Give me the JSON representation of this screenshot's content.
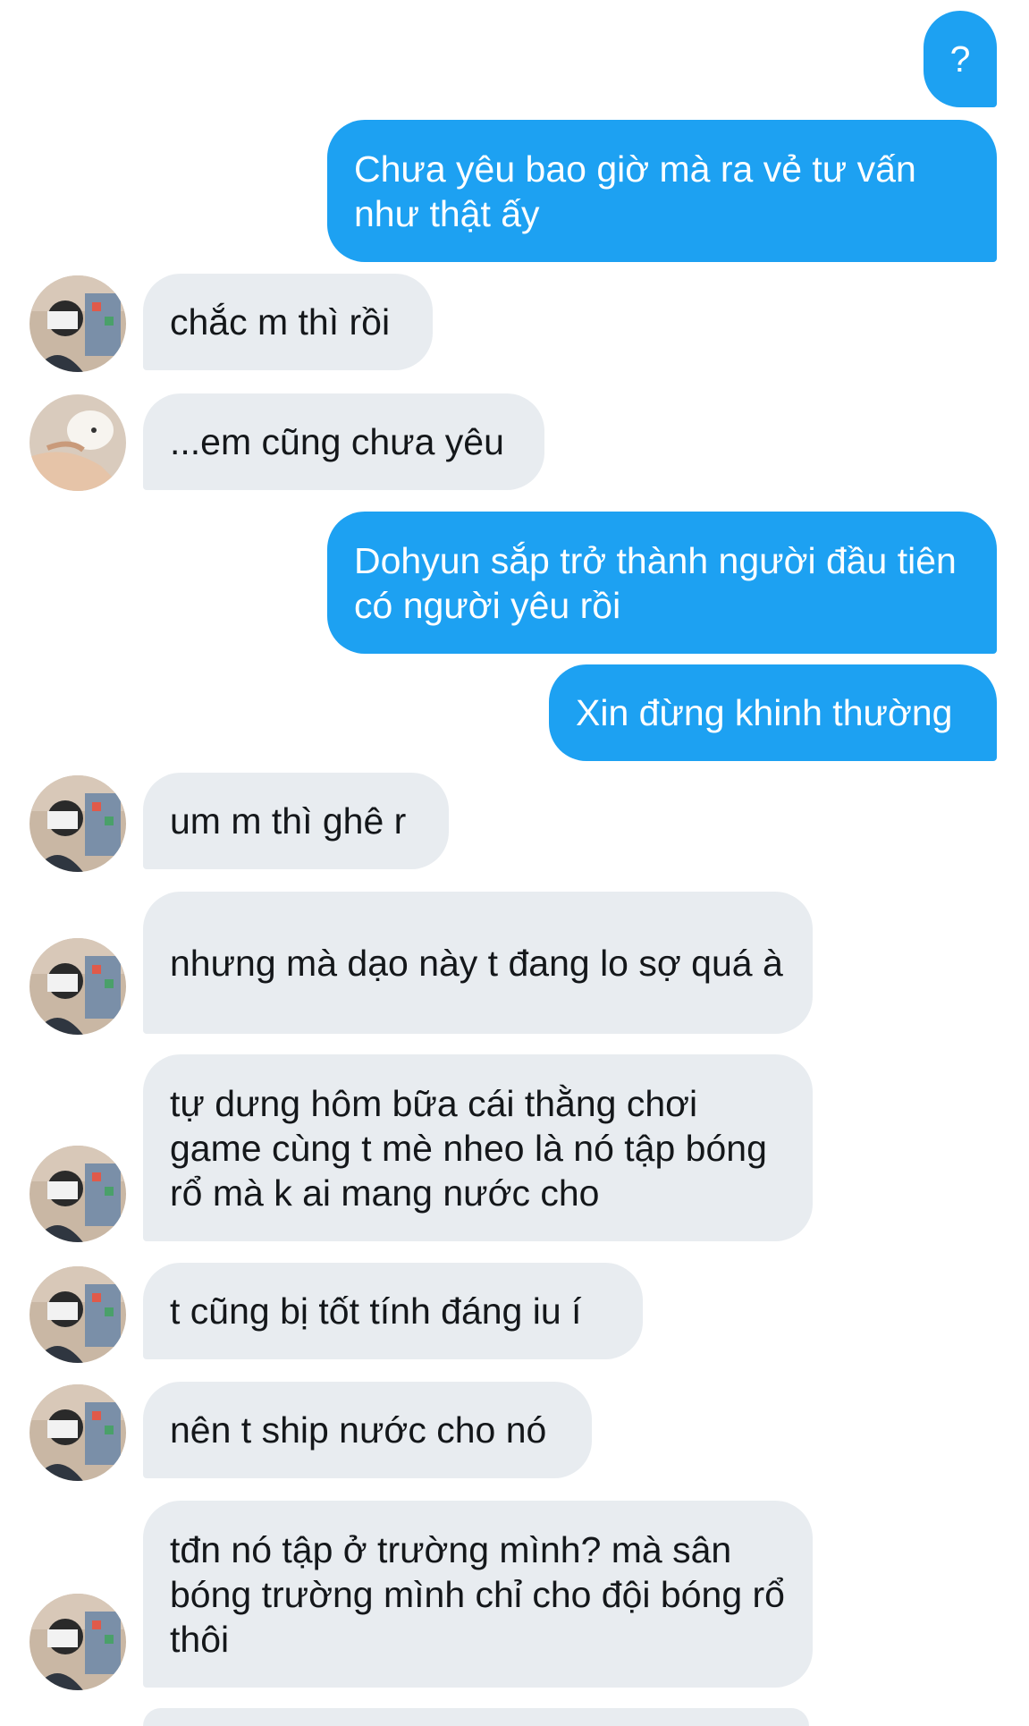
{
  "messages": [
    {
      "side": "sent",
      "text": "?"
    },
    {
      "side": "sent",
      "text": "Chưa yêu bao giờ mà ra vẻ tư vấn như thật ấy"
    },
    {
      "side": "recv",
      "text": "chắc m thì rồi",
      "avatar": "person-selfie"
    },
    {
      "side": "recv",
      "text": "...em cũng chưa yêu",
      "avatar": "dog-photo"
    },
    {
      "side": "sent",
      "text": "Dohyun sắp trở thành người đầu tiên có người yêu rồi"
    },
    {
      "side": "sent",
      "text": "Xin đừng khinh thường"
    },
    {
      "side": "recv",
      "text": "um m thì ghê r",
      "avatar": "person-selfie"
    },
    {
      "side": "recv",
      "text": "nhưng mà dạo này t đang lo sợ quá à",
      "avatar": "person-selfie"
    },
    {
      "side": "recv",
      "text": "tự dưng hôm bữa cái thằng chơi game cùng t mè nheo là nó tập bóng rổ mà k ai mang nước cho",
      "avatar": "person-selfie"
    },
    {
      "side": "recv",
      "text": "t cũng bị tốt tính đáng iu í",
      "avatar": "person-selfie"
    },
    {
      "side": "recv",
      "text": "nên t ship nước cho nó",
      "avatar": "person-selfie"
    },
    {
      "side": "recv",
      "text": "tđn nó tập ở trường mình? mà sân bóng trường mình chỉ cho đội bóng rổ thôi",
      "avatar": "person-selfie"
    }
  ],
  "colors": {
    "sent_bubble": "#1da1f2",
    "received_bubble": "#e8ecf0",
    "received_text": "#14171a",
    "background": "#ffffff"
  }
}
